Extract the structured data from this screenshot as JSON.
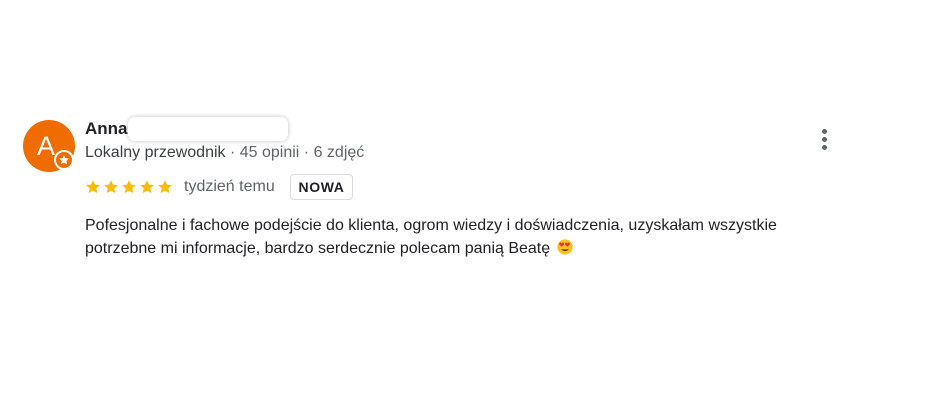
{
  "review": {
    "avatar_letter": "A",
    "reviewer_name": "Anna",
    "reviewer_meta": {
      "guide_label": "Lokalny przewodnik",
      "separator": " · ",
      "reviews_count": "45 opinii",
      "photos_count": "6 zdjęć"
    },
    "rating": 5,
    "date": "tydzień temu",
    "new_badge": "NOWA",
    "text_line_1": "Pofesjonalne i fachowe podejście do klienta, ogrom wiedzy i doświadczenia, uzyskałam wszystkie",
    "text_line_2": "potrzebne mi informacje, bardzo serdecznie polecam panią Beatę",
    "icons": {
      "menu": "more-vert-icon",
      "badge": "local-guide-star-icon",
      "emoji": "heart-eyes-emoji-icon",
      "rating": "star-icon"
    },
    "colors": {
      "avatar": "#ef6c00",
      "star": "#fbbc04",
      "secondary_text": "#5f6368",
      "primary_text": "#202124"
    }
  }
}
